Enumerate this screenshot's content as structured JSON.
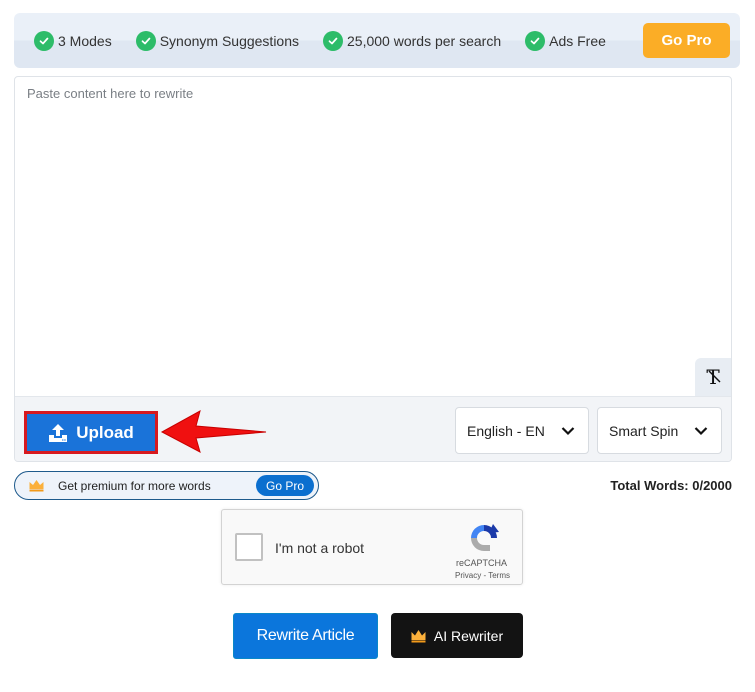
{
  "feature_bar": {
    "features": [
      {
        "label": "3 Modes",
        "icon": "check-circle-icon"
      },
      {
        "label": "Synonym Suggestions",
        "icon": "check-circle-icon"
      },
      {
        "label": "25,000 words per search",
        "icon": "check-circle-icon"
      },
      {
        "label": "Ads Free",
        "icon": "check-circle-icon"
      }
    ],
    "go_pro_label": "Go Pro",
    "colors": {
      "check": "#2dbc69",
      "go_pro": "#fbad26"
    }
  },
  "editor": {
    "placeholder": "Paste content here to rewrite",
    "value": "",
    "format_icon": "clear-formatting-icon",
    "format_glyph": "T"
  },
  "toolbar": {
    "upload_label": "Upload",
    "language": {
      "selected": "English - EN"
    },
    "mode": {
      "selected": "Smart Spin"
    }
  },
  "premium": {
    "text": "Get premium for more words",
    "go_pro_label": "Go Pro"
  },
  "total_words": "Total Words: 0/2000",
  "captcha": {
    "label": "I'm not a robot",
    "brand": "reCAPTCHA",
    "privacy": "Privacy",
    "separator": " - ",
    "terms": "Terms",
    "checked": false
  },
  "actions": {
    "rewrite_label": "Rewrite Article",
    "ai_rewriter_label": "AI Rewriter",
    "colors": {
      "rewrite": "#0b76dc",
      "ai": "#131313"
    }
  }
}
